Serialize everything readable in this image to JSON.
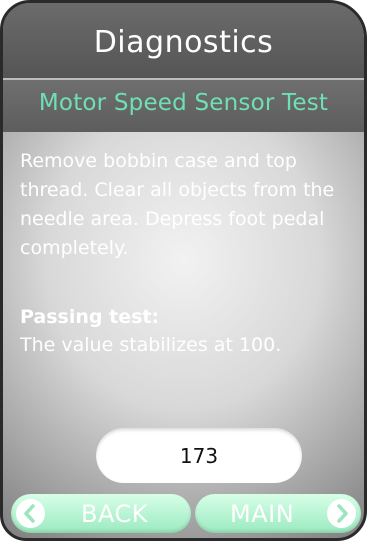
{
  "header": {
    "title": "Diagnostics"
  },
  "test": {
    "name": "Motor Speed Sensor Test",
    "instructions": "Remove bobbin case and top thread. Clear all objects from the needle area. Depress foot pedal completely.",
    "passing_label": "Passing test:",
    "passing_text": "The value stabilizes at 100."
  },
  "readout": {
    "value": "173"
  },
  "nav": {
    "back_label": "BACK",
    "main_label": "MAIN",
    "back_icon": "chevron-left-icon",
    "main_icon": "chevron-right-icon"
  },
  "colors": {
    "accent": "#6fe0b5",
    "button": "#b8f3d3",
    "header": "#606060"
  }
}
